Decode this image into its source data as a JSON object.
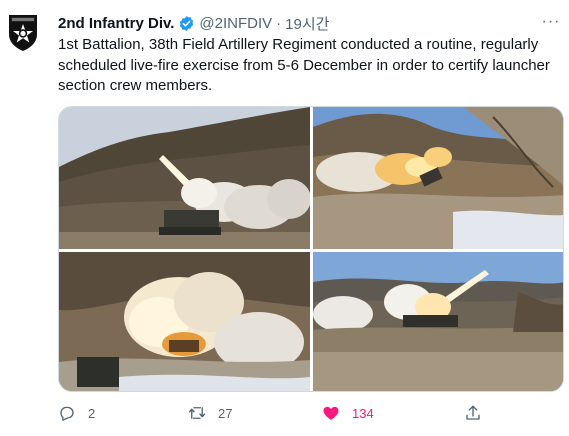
{
  "tweet": {
    "author_name": "2nd Infantry Div.",
    "handle": "@2INFDIV",
    "separator": "·",
    "time": "19시간",
    "more_label": "···",
    "text_lines": [
      "1st Battalion, 38th Field Artillery Regiment conducted a routine, regularly",
      "scheduled live-fire exercise from 5-6 December in order to certify launcher",
      "section crew members."
    ],
    "stats": {
      "replies": "2",
      "retweets": "27",
      "likes": "134"
    }
  },
  "colors": {
    "verified_blue": "#1d9bf0",
    "like_pink": "#f91880",
    "secondary_text": "#536471"
  },
  "icons": {
    "reply": "reply-icon",
    "retweet": "retweet-icon",
    "like": "heart-icon",
    "share": "share-icon",
    "verified": "verified-badge-icon"
  }
}
